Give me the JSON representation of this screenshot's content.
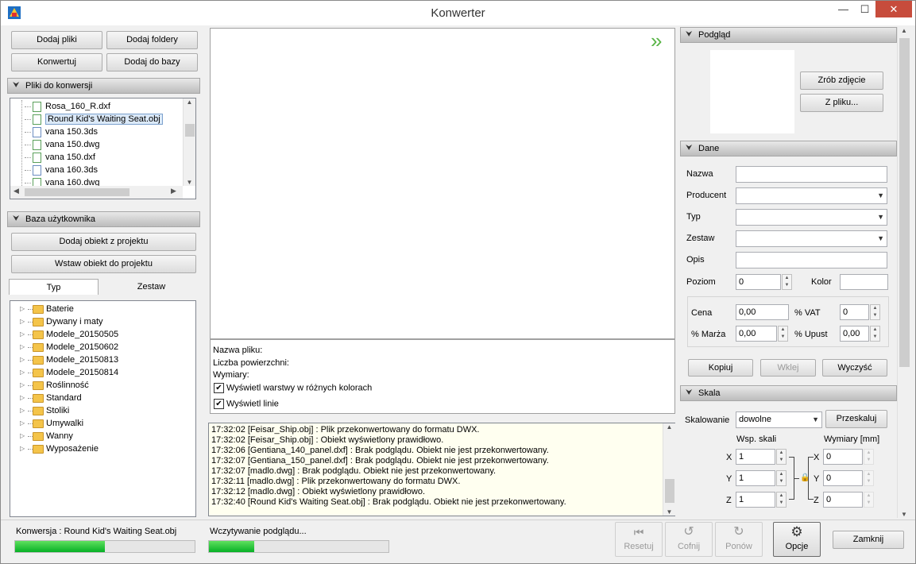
{
  "window": {
    "title": "Konwerter",
    "minimize": "—",
    "maximize": "☐",
    "close": "✕"
  },
  "left": {
    "buttons": {
      "add_files": "Dodaj pliki",
      "add_folders": "Dodaj foldery",
      "convert": "Konwertuj",
      "add_to_db": "Dodaj do bazy"
    },
    "files_header": "Pliki do konwersji",
    "files": [
      {
        "name": "Rosa_160_R.dxf",
        "icon": "green"
      },
      {
        "name": "Round Kid's Waiting Seat.obj",
        "icon": "green",
        "selected": true
      },
      {
        "name": "vana 150.3ds",
        "icon": "blue"
      },
      {
        "name": "vana 150.dwg",
        "icon": "green"
      },
      {
        "name": "vana 150.dxf",
        "icon": "green"
      },
      {
        "name": "vana 160.3ds",
        "icon": "blue"
      },
      {
        "name": "vana 160.dwg",
        "icon": "green"
      }
    ],
    "user_db_header": "Baza użytkownika",
    "add_object_btn": "Dodaj obiekt z projektu",
    "insert_object_btn": "Wstaw obiekt do projektu",
    "tabs": {
      "type": "Typ",
      "set": "Zestaw"
    },
    "folders": [
      "Baterie",
      "Dywany i maty",
      "Modele_20150505",
      "Modele_20150602",
      "Modele_20150813",
      "Modele_20150814",
      "Roślinność",
      "Standard",
      "Stoliki",
      "Umywalki",
      "Wanny",
      "Wyposażenie"
    ]
  },
  "center": {
    "arrow_icon": "»",
    "info": {
      "file_name": "Nazwa pliku:",
      "surfaces": "Liczba powierzchni:",
      "dimensions": "Wymiary:"
    },
    "check_layers": "Wyświetl warstwy w różnych kolorach",
    "check_lines": "Wyświetl linie",
    "log": [
      "17:32:02 [Feisar_Ship.obj] : Plik przekonwertowany do formatu DWX.",
      "17:32:02 [Feisar_Ship.obj] : Obiekt wyświetlony prawidłowo.",
      "17:32:06 [Gentiana_140_panel.dxf] : Brak podglądu. Obiekt nie jest przekonwertowany.",
      "17:32:07 [Gentiana_150_panel.dxf] : Brak podglądu. Obiekt nie jest przekonwertowany.",
      "17:32:07 [madlo.dwg] : Brak podglądu. Obiekt nie jest przekonwertowany.",
      "17:32:11 [madlo.dwg] : Plik przekonwertowany do formatu DWX.",
      "17:32:12 [madlo.dwg] : Obiekt wyświetlony prawidłowo.",
      "17:32:40 [Round Kid's Waiting Seat.obj] : Brak podglądu. Obiekt nie jest przekonwertowany."
    ]
  },
  "right": {
    "preview_header": "Podgląd",
    "take_photo": "Zrób zdjęcie",
    "from_file": "Z pliku...",
    "data_header": "Dane",
    "labels": {
      "name": "Nazwa",
      "producer": "Producent",
      "type": "Typ",
      "set": "Zestaw",
      "desc": "Opis",
      "level": "Poziom",
      "color": "Kolor",
      "price": "Cena",
      "vat": "% VAT",
      "margin": "% Marża",
      "discount": "% Upust"
    },
    "values": {
      "level": "0",
      "price": "0,00",
      "vat": "0",
      "margin": "0,00",
      "discount": "0,00"
    },
    "copy": "Kopiuj",
    "paste": "Wklej",
    "clear": "Wyczyść",
    "scale_header": "Skala",
    "scaling_label": "Skalowanie",
    "scaling_value": "dowolne",
    "rescale": "Przeskaluj",
    "scale_coef": "Wsp. skali",
    "dims_mm": "Wymiary [mm]",
    "axes": [
      "X",
      "Y",
      "Z"
    ],
    "scale_vals": [
      "1",
      "1",
      "1"
    ],
    "dim_vals": [
      "0",
      "0",
      "0"
    ]
  },
  "status": {
    "conversion": "Konwersja : Round Kid's Waiting Seat.obj",
    "conversion_progress": 0.5,
    "loading": "Wczytywanie podglądu...",
    "loading_progress": 0.25
  },
  "toolbar": {
    "reset": "Resetuj",
    "undo": "Cofnij",
    "redo": "Ponów",
    "options": "Opcje",
    "close": "Zamknij"
  }
}
